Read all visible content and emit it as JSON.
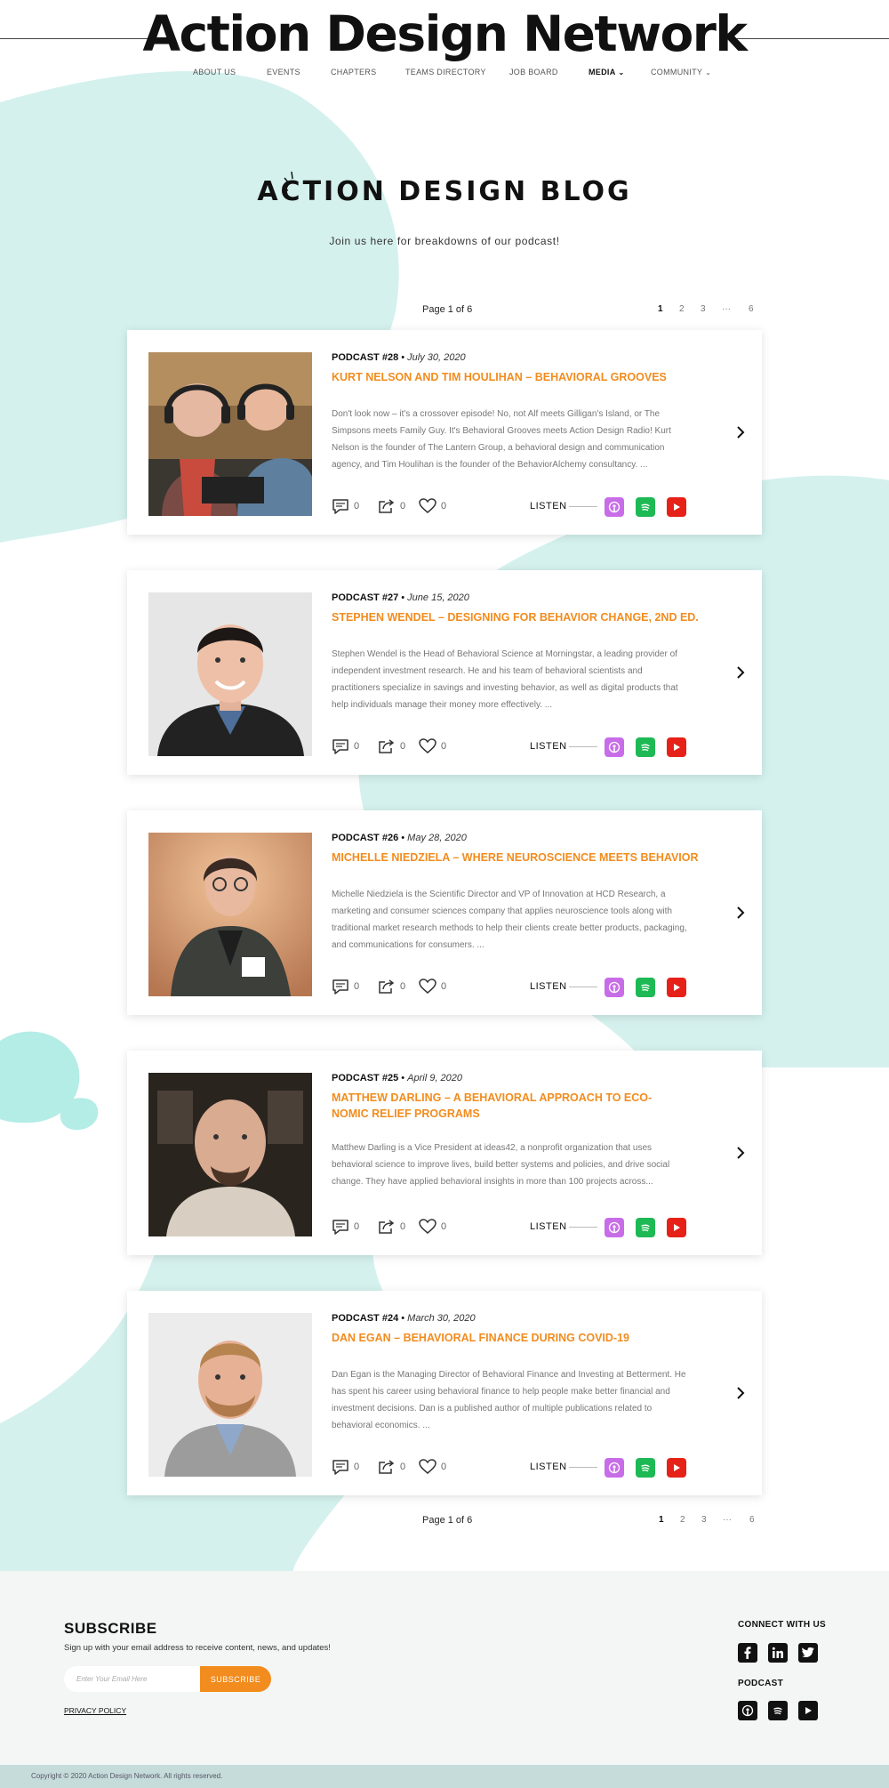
{
  "site": {
    "title": "Action Design Network"
  },
  "nav": [
    {
      "label": "ABOUT US",
      "active": false,
      "dropdown": false
    },
    {
      "label": "EVENTS",
      "active": false,
      "dropdown": false
    },
    {
      "label": "CHAPTERS",
      "active": false,
      "dropdown": false
    },
    {
      "label": "TEAMS DIRECTORY",
      "active": false,
      "dropdown": false
    },
    {
      "label": "JOB BOARD",
      "active": false,
      "dropdown": false
    },
    {
      "label": "MEDIA",
      "active": true,
      "dropdown": true
    },
    {
      "label": "COMMUNITY",
      "active": false,
      "dropdown": true
    }
  ],
  "blog": {
    "heading": "ACTION DESIGN BLOG",
    "subtitle": "Join us here for breakdowns of our podcast!"
  },
  "pagination": {
    "label": "Page 1 of 6",
    "pages": [
      "1",
      "2",
      "3",
      "···",
      "6"
    ],
    "current": "1"
  },
  "posts": [
    {
      "number": "PODCAST #28",
      "date": "July 30, 2020",
      "title": "KURT NELSON AND TIM HOULIHAN – BEHAVIORAL GROOVES",
      "excerpt": "Don't look now – it's a crossover episode! No, not Alf meets Gilligan's Island, or The Simpsons meets Family Guy. It's Behavioral Grooves meets Action Design Radio! Kurt Nelson is the founder of The Lantern Group, a behavioral design and communication agency, and Tim Houlihan is the founder of the BehaviorAlchemy consultancy. ...",
      "comments": "0",
      "shares": "0",
      "likes": "0"
    },
    {
      "number": "PODCAST #27",
      "date": "June 15, 2020",
      "title": "STEPHEN WENDEL – DESIGNING FOR BEHAVIOR CHANGE, 2ND ED.",
      "excerpt": "Stephen Wendel is the Head of Behavioral Science at Morningstar, a leading provider of independent investment research. He and his team of behavioral scientists and practitioners specialize in savings and investing behavior, as well as digital products that help individuals manage their money more effectively. ...",
      "comments": "0",
      "shares": "0",
      "likes": "0"
    },
    {
      "number": "PODCAST #26",
      "date": "May 28, 2020",
      "title": "MICHELLE NIEDZIELA – WHERE NEUROSCIENCE MEETS BEHAVIOR",
      "excerpt": "Michelle Niedziela is the Scientific Director and VP of Innovation at HCD Research, a marketing and consumer sciences company that applies neuroscience tools along with traditional market research methods to help their clients create better products, packaging, and communications for consumers. ...",
      "comments": "0",
      "shares": "0",
      "likes": "0"
    },
    {
      "number": "PODCAST #25",
      "date": "April 9, 2020",
      "title": "MATTHEW DARLING – A BEHAVIORAL APPROACH TO ECO-NOMIC RELIEF PROGRAMS",
      "excerpt": "Matthew Darling is a Vice President at ideas42, a nonprofit organization that uses behavioral science to improve lives, build better systems and policies, and drive social change. They have applied behavioral insights in more than 100 projects across...",
      "comments": "0",
      "shares": "0",
      "likes": "0"
    },
    {
      "number": "PODCAST #24",
      "date": "March 30, 2020",
      "title": "DAN EGAN – BEHAVIORAL FINANCE DURING COVID-19",
      "excerpt": "Dan Egan is the Managing Director of Behavioral Finance and Investing at Betterment. He has spent his career using behavioral finance to help people make better financial and investment decisions. Dan is a published author of multiple publications related to behavioral economics. ...",
      "comments": "0",
      "shares": "0",
      "likes": "0"
    }
  ],
  "listen_label": "LISTEN",
  "podcast_services": [
    {
      "icon": "apple-podcasts-icon",
      "color": "#c86de8"
    },
    {
      "icon": "spotify-icon",
      "color": "#1db954"
    },
    {
      "icon": "youtube-icon",
      "color": "#e62117"
    }
  ],
  "footer": {
    "subscribe_title": "SUBSCRIBE",
    "subscribe_text": "Sign up with your email address to receive content, news, and updates!",
    "email_placeholder": "Enter Your Email Here",
    "subscribe_button": "SUBSCRIBE",
    "privacy": "PRIVACY POLICY",
    "connect_title": "CONNECT WITH US",
    "social": [
      "facebook-icon",
      "linkedin-icon",
      "twitter-icon"
    ],
    "podcast_title": "PODCAST",
    "podcast_links": [
      "apple-podcasts-icon",
      "spotify-icon",
      "youtube-icon"
    ],
    "copyright": "Copyright © 2020 Action Design Network. All rights reserved."
  },
  "colors": {
    "accent": "#f28c1e",
    "blob": "#d2f0ee",
    "footer_bg": "#f3f6f4",
    "copyright_bg": "#c6dcda"
  }
}
